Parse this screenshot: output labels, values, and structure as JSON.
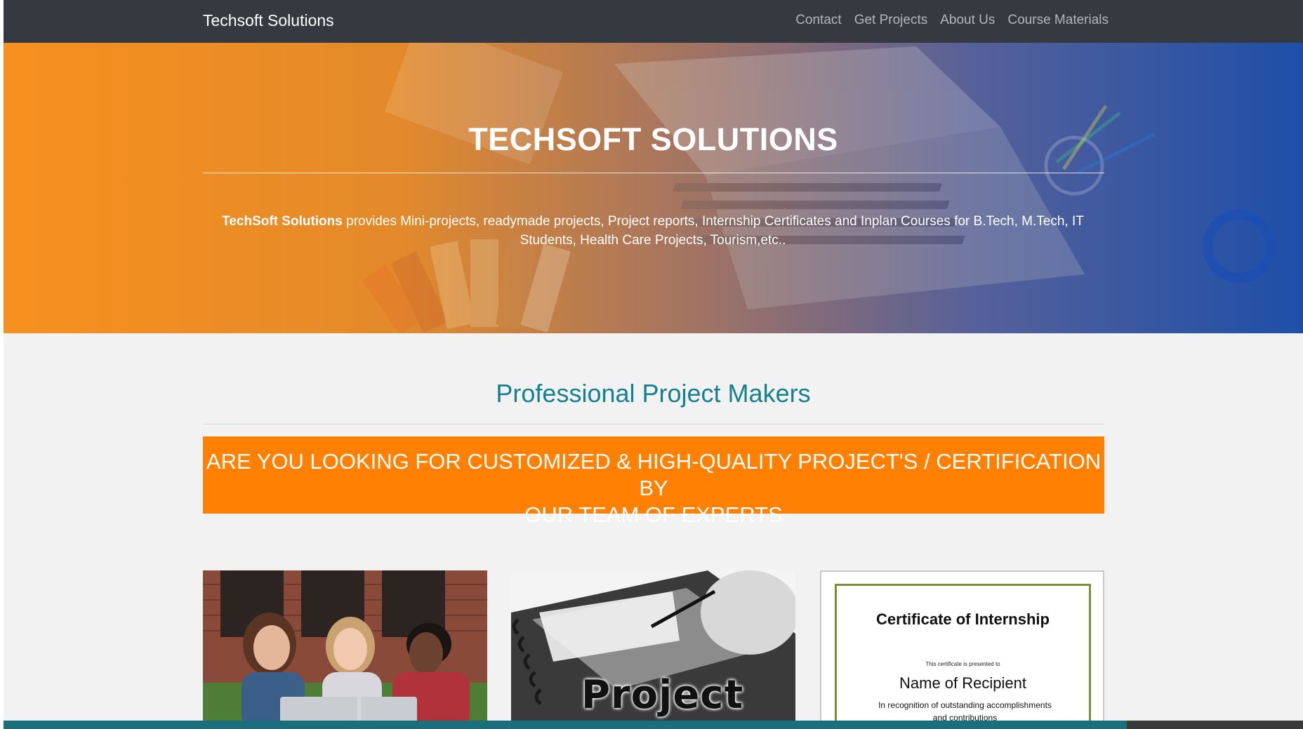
{
  "navbar": {
    "brand": "Techsoft Solutions",
    "links": [
      "Contact",
      "Get Projects",
      "About Us",
      "Course Materials"
    ]
  },
  "hero": {
    "title": "TECHSOFT SOLUTIONS",
    "desc_bold": "TechSoft Solutions",
    "desc_line1": " provides Mini-projects, readymade projects, Project reports, Internship Certificates and Inplan Courses for B.Tech, M.Tech, IT",
    "desc_line2": "Students, Health Care Projects, Tourism,etc.."
  },
  "section": {
    "title": "Professional Project Makers",
    "banner_line1": "ARE YOU LOOKING FOR CUSTOMIZED & HIGH-QUALITY PROJECT'S / CERTIFICATION BY",
    "banner_line2": "OUR TEAM OF EXPERTS"
  },
  "cards": {
    "project_word": "Project",
    "certificate": {
      "title": "Certificate of Internship",
      "presented": "This certificate is presented to",
      "name": "Name of Recipient",
      "recognition_line1": "In recognition of outstanding accomplishments",
      "recognition_line2": "and contributions"
    }
  },
  "colors": {
    "navbar": "#343a40",
    "accent_teal": "#17808f",
    "banner_orange": "#ff8003"
  }
}
